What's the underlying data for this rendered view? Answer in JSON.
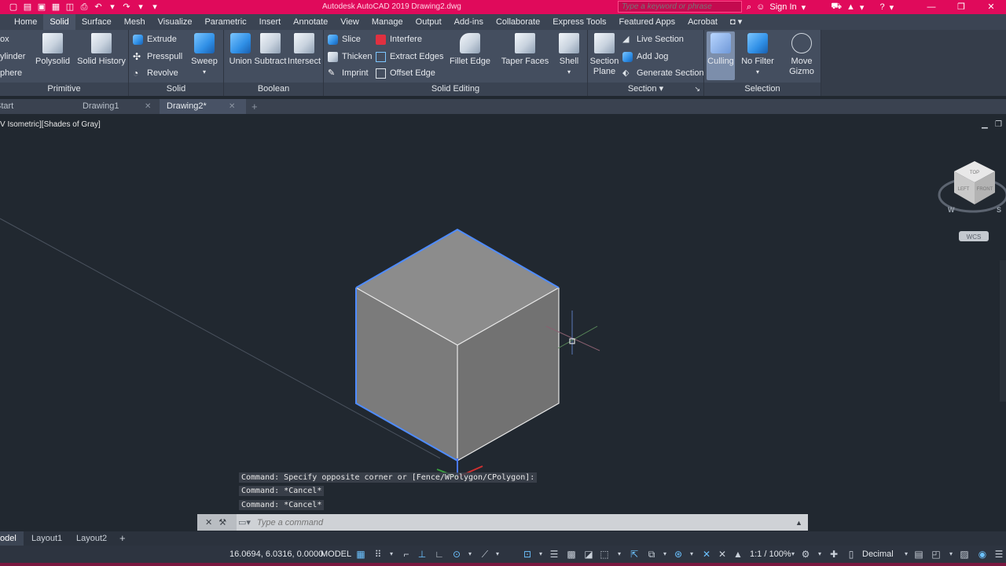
{
  "app": {
    "title": "Autodesk AutoCAD 2019    Drawing2.dwg",
    "search_placeholder": "Type a keyword or phrase",
    "sign_in": "Sign In"
  },
  "ribbon_tabs": [
    "Home",
    "Solid",
    "Surface",
    "Mesh",
    "Visualize",
    "Parametric",
    "Insert",
    "Annotate",
    "View",
    "Manage",
    "Output",
    "Add-ins",
    "Collaborate",
    "Express Tools",
    "Featured Apps",
    "Acrobat"
  ],
  "ribbon": {
    "primitive": {
      "label": "Primitive",
      "box": "ox",
      "cylinder": "ylinder",
      "sphere": "phere",
      "polysolid": "Polysolid",
      "solid_history": "Solid History"
    },
    "solid": {
      "label": "Solid",
      "extrude": "Extrude",
      "presspull": "Presspull",
      "revolve": "Revolve",
      "sweep": "Sweep"
    },
    "boolean": {
      "label": "Boolean",
      "union": "Union",
      "subtract": "Subtract",
      "intersect": "Intersect"
    },
    "solid_editing": {
      "label": "Solid Editing",
      "slice": "Slice",
      "thicken": "Thicken",
      "imprint": "Imprint",
      "interfere": "Interfere",
      "extract_edges": "Extract Edges",
      "offset_edge": "Offset Edge",
      "fillet_edge": "Fillet Edge",
      "taper_faces": "Taper Faces",
      "shell": "Shell"
    },
    "section": {
      "label": "Section",
      "section_plane_1": "Section",
      "section_plane_2": "Plane",
      "live_section": "Live Section",
      "add_jog": "Add Jog",
      "generate_section": "Generate Section"
    },
    "selection": {
      "label": "Selection",
      "culling": "Culling",
      "no_filter": "No Filter",
      "move_gizmo_1": "Move",
      "move_gizmo_2": "Gizmo"
    }
  },
  "doc_tabs": [
    "Start",
    "Drawing1",
    "Drawing2*"
  ],
  "viewport": {
    "label": "[-][SW Isometric][Shades of Gray]",
    "label_visible": "V Isometric][Shades of Gray]",
    "wcs": "WCS",
    "viewcube": {
      "top": "TOP",
      "left": "LEFT",
      "front": "FRONT",
      "w": "W",
      "s": "S"
    }
  },
  "command_history": [
    "Command: Specify opposite corner or [Fence/WPolygon/CPolygon]:",
    "Command: *Cancel*",
    "Command: *Cancel*"
  ],
  "command_placeholder": "Type a command",
  "layout_tabs": [
    "odel",
    "Layout1",
    "Layout2"
  ],
  "status": {
    "coords": "16.0694, 6.0316, 0.0000",
    "model": "MODEL",
    "scale": "1:1 / 100%",
    "units": "Decimal"
  },
  "colors": {
    "accent": "#e00a5b",
    "ribbon": "#444e5f",
    "viewport": "#212830",
    "selection": "#4f8cff"
  }
}
